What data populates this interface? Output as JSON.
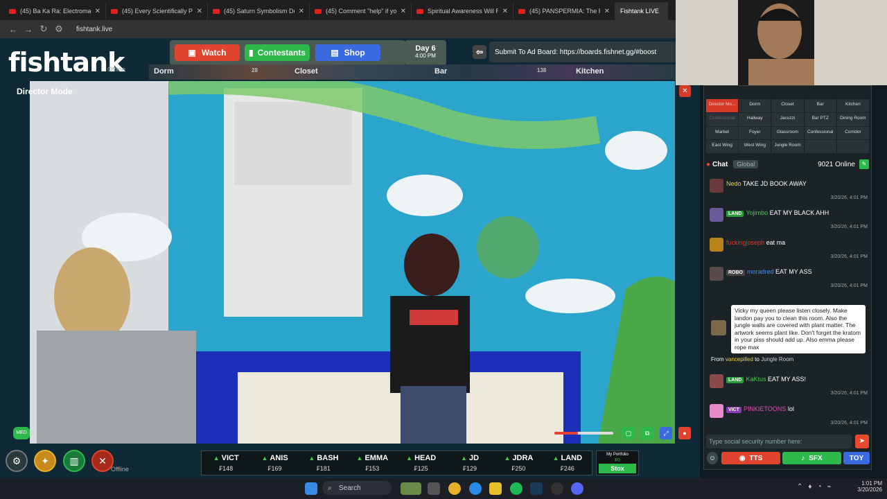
{
  "browser": {
    "tabs": [
      {
        "title": "(45) Ba Ka Ra: Electromagne"
      },
      {
        "title": "(45) Every Scientifically Prov"
      },
      {
        "title": "(45) Saturn Symbolism Deep"
      },
      {
        "title": "(45) Comment \"help\" if you"
      },
      {
        "title": "Spiritual Awareness Will Rui"
      },
      {
        "title": "(45) PANSPERMIA: The Radi"
      },
      {
        "title": "Fishtank LIVE"
      }
    ],
    "url": "fishtank.live"
  },
  "site": {
    "logo": "fishtank",
    "offline_label": "Offline",
    "nav": {
      "watch": "Watch",
      "contestants": "Contestants",
      "shop": "Shop"
    },
    "day": {
      "label": "Day 6",
      "time": "4:00 PM"
    },
    "ad_board": "Submit To Ad Board: https://boards.fishnet.gg/#boost",
    "room_strip": [
      "Dorm",
      "Closet",
      "Bar",
      "Kitchen"
    ],
    "strip_counts": [
      "28",
      "138"
    ],
    "director_mode": "Director Mode",
    "med_label": "MED"
  },
  "rooms_panel": {
    "rooms": [
      "Director Mo...",
      "Dorm",
      "Closet",
      "Bar",
      "Kitchen",
      "Confessional",
      "Hallway",
      "Jacuzzi",
      "Bar PTZ",
      "Dining Room",
      "Market",
      "Foyer",
      "Glassroom",
      "Confessional",
      "Corridor",
      "East Wing",
      "West Wing",
      "Jungle Room",
      "",
      ""
    ]
  },
  "chat": {
    "title": "Chat",
    "scope": "Global",
    "online": "9021 Online",
    "messages": [
      {
        "user": "Nedo",
        "badge": "",
        "text": "TAKE JD BOOK AWAY",
        "time": "3/20/26, 4:01 PM",
        "user_color": "#e8d13a",
        "badge_color": ""
      },
      {
        "user": "Yojimbo",
        "badge": "LAND",
        "text": "EAT MY BLACK AHH",
        "time": "3/20/26, 4:01 PM",
        "user_color": "#45c94a",
        "badge_color": "#2a9a3a"
      },
      {
        "user": "fuckingjoseph",
        "badge": "",
        "text": "eat ma",
        "time": "3/20/26, 4:01 PM",
        "user_color": "#d63a2a",
        "badge_color": ""
      },
      {
        "user": "moradred",
        "badge": "ROBO",
        "text": "EAT MY ASS",
        "time": "3/20/26, 4:01 PM",
        "user_color": "#4a8ae8",
        "badge_color": "#444"
      },
      {
        "user": "KaKtus",
        "badge": "LAND",
        "text": "EAT MY ASS!",
        "time": "3/20/26, 4:01 PM",
        "user_color": "#45c94a",
        "badge_color": "#2a9a3a"
      },
      {
        "user": "PINKIETOONS",
        "badge": "VICT",
        "text": "lol",
        "time": "3/20/26, 4:01 PM",
        "user_color": "#e84ab8",
        "badge_color": "#8a3ab8"
      }
    ],
    "tts_message": "Vicky my queen please listen closely. Make landon pay you to clean this room. Also the jungle walls are covered with plant matter. The artwork seems plant like. Don't forget the kratom in your piss should add up. Also emma please rope max",
    "tts_from_prefix": "From",
    "tts_from": "vancepilled",
    "tts_to_prefix": "to",
    "tts_to": "Jungle Room",
    "input_placeholder": "Type social security number here:",
    "buttons": {
      "tts": "TTS",
      "sfx": "SFX",
      "toy": "TOY"
    }
  },
  "contestants": [
    {
      "name": "VICT",
      "value": "148"
    },
    {
      "name": "ANIS",
      "value": "169"
    },
    {
      "name": "BASH",
      "value": "181"
    },
    {
      "name": "EMMA",
      "value": "153"
    },
    {
      "name": "HEAD",
      "value": "125"
    },
    {
      "name": "JD",
      "value": "129"
    },
    {
      "name": "JDRA",
      "value": "250"
    },
    {
      "name": "LAND",
      "value": "246"
    }
  ],
  "portfolio": {
    "label": "My Portfolio",
    "value": "0",
    "button": "Stox"
  },
  "taskbar": {
    "search": "Search",
    "time": "1:01 PM",
    "date": "3/20/2026"
  },
  "colors": {
    "accent": "#e84a2e",
    "green": "#2db84a",
    "blue": "#3a6ae0"
  }
}
